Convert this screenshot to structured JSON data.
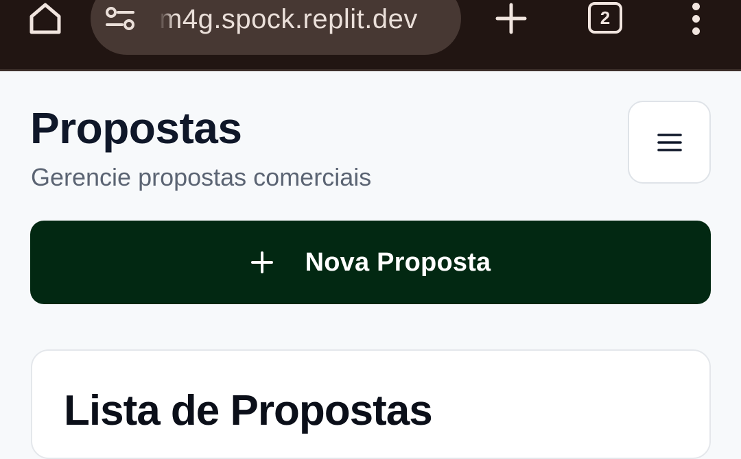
{
  "browser": {
    "url": "m4g.spock.replit.dev",
    "tab_count": "2",
    "icons": [
      "home-icon",
      "site-settings-icon",
      "plus-icon",
      "tab-switcher-icon",
      "kebab-menu-icon"
    ],
    "bar_color": "#211512",
    "pill_color": "#473833"
  },
  "header": {
    "title": "Propostas",
    "subtitle": "Gerencie propostas comerciais",
    "menu_icon": "hamburger-icon"
  },
  "actions": {
    "new_proposal_label": "Nova Proposta",
    "new_proposal_icon": "plus-icon",
    "primary_color": "#022812"
  },
  "card": {
    "title": "Lista de Propostas"
  }
}
